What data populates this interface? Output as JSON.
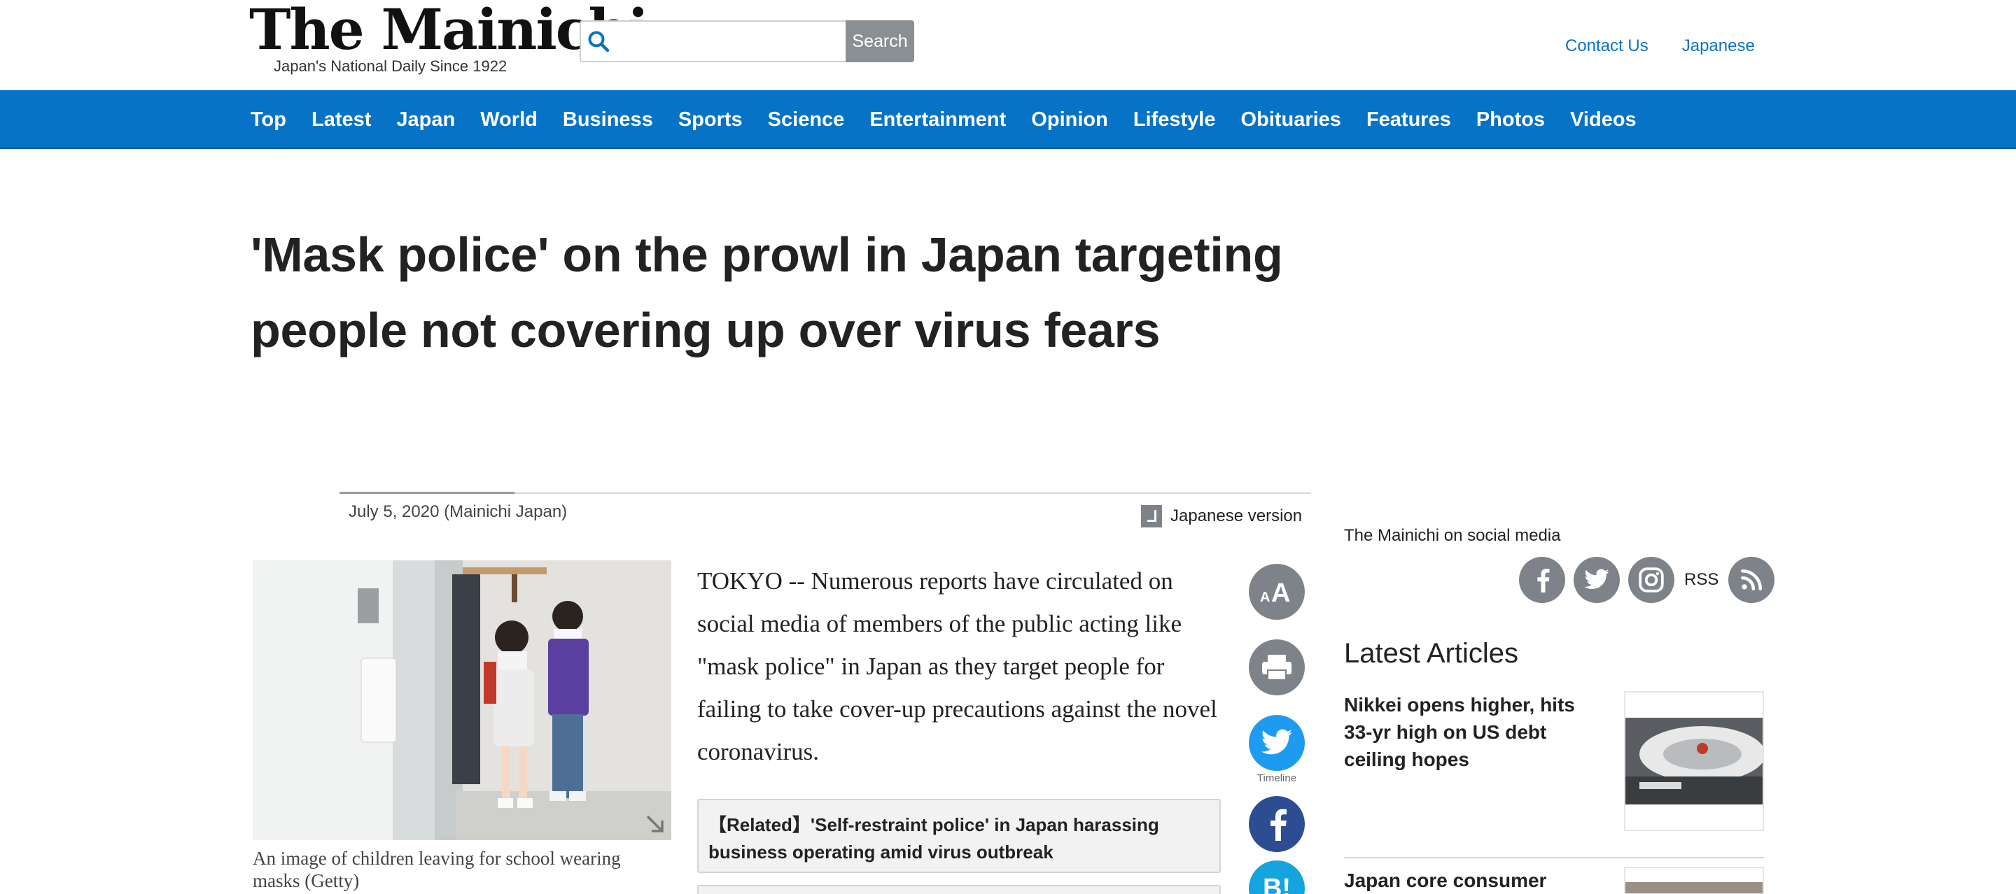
{
  "header": {
    "logo_title": "The Mainichi",
    "logo_subtitle": "Japan's National Daily Since 1922",
    "search_placeholder": "",
    "search_button": "Search",
    "links": [
      "Contact Us",
      "Japanese"
    ]
  },
  "nav": {
    "items": [
      "Top",
      "Latest",
      "Japan",
      "World",
      "Business",
      "Sports",
      "Science",
      "Entertainment",
      "Opinion",
      "Lifestyle",
      "Obituaries",
      "Features",
      "Photos",
      "Videos"
    ]
  },
  "article": {
    "headline": "'Mask police' on the prowl in Japan targeting people not covering up over virus fears",
    "date": "July 5, 2020 (Mainichi Japan)",
    "japanese_version": "Japanese version",
    "photo_caption": "An image of children leaving for school wearing masks (Getty)",
    "body": "TOKYO -- Numerous reports have circulated on social media of members of the public acting like \"mask police\" in Japan as they target people for failing to take cover-up precautions against the novel coronavirus.",
    "related": "【Related】'Self-restraint police' in Japan harassing business operating amid virus outbreak"
  },
  "share": {
    "font_size_label": "AA",
    "timeline_label": "Timeline",
    "hatena_label": "B!",
    "icons": [
      "font-size-icon",
      "print-icon",
      "twitter-icon",
      "facebook-icon",
      "hatena-bookmark-icon"
    ]
  },
  "sidebar": {
    "social_title": "The Mainichi on social media",
    "rss_label": "RSS",
    "latest_title": "Latest Articles",
    "latest": [
      {
        "title": "Nikkei opens higher, hits 33-yr high on US debt ceiling hopes"
      },
      {
        "title": "Japan core consumer"
      }
    ]
  },
  "colors": {
    "nav_blue": "#0773c7",
    "link_blue": "#0b73c2",
    "icon_gray": "#7d8388",
    "twitter": "#1d9bf0",
    "facebook": "#2d4d92",
    "hatena": "#14a4de"
  }
}
